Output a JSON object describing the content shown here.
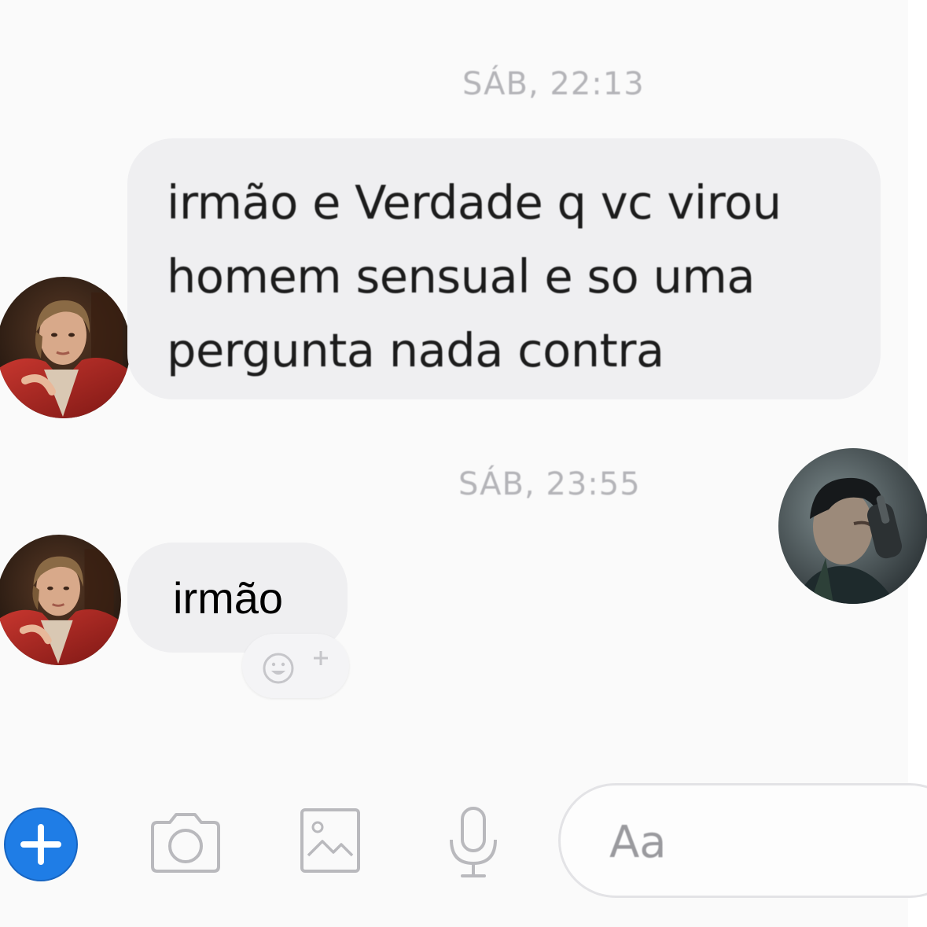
{
  "conversation": {
    "timestamps": [
      "SÁB, 22:13",
      "SÁB, 23:55"
    ],
    "messages": [
      {
        "sender": "contact",
        "text": "irmão e Verdade q vc virou homem sensual e so uma pergunta nada contra"
      },
      {
        "sender": "contact",
        "text": "irmão"
      }
    ]
  },
  "composer": {
    "placeholder": "Aa",
    "icons": [
      "plus-icon",
      "camera-icon",
      "gallery-icon",
      "microphone-icon"
    ],
    "accent_color": "#1877f2"
  },
  "reaction": {
    "icon": "add-reaction-icon"
  },
  "avatars": {
    "contact": "red-jacket-woman-avatar",
    "self": "dark-haired-man-avatar"
  }
}
